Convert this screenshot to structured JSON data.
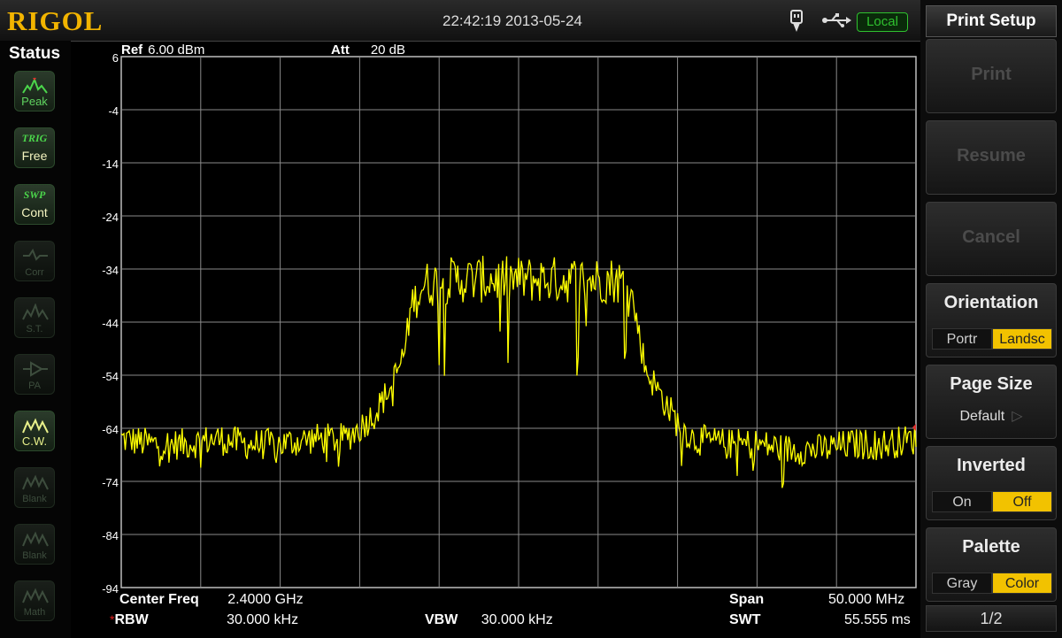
{
  "brand": "RIGOL",
  "datetime": "22:42:19 2013-05-24",
  "connection": "Local",
  "status": {
    "title": "Status",
    "buttons": [
      {
        "tag": "",
        "label": "Peak",
        "icon": "peak-icon",
        "active": true
      },
      {
        "tag": "TRIG",
        "label": "Free",
        "icon": "",
        "active": true
      },
      {
        "tag": "SWP",
        "label": "Cont",
        "icon": "",
        "active": true
      },
      {
        "tag": "",
        "label": "Corr",
        "icon": "correction-icon",
        "active": false
      },
      {
        "tag": "",
        "label": "S.T.",
        "icon": "signal-track-icon",
        "active": false
      },
      {
        "tag": "",
        "label": "PA",
        "icon": "preamp-icon",
        "active": false
      },
      {
        "tag": "",
        "label": "C.W.",
        "icon": "trace-icon",
        "active": true
      },
      {
        "tag": "",
        "label": "Blank",
        "icon": "trace-icon",
        "active": false
      },
      {
        "tag": "",
        "label": "Blank",
        "icon": "trace-icon",
        "active": false
      },
      {
        "tag": "",
        "label": "Math",
        "icon": "trace-icon",
        "active": false
      }
    ]
  },
  "measurement": {
    "ref_label": "Ref",
    "ref_value": "6.00 dBm",
    "att_label": "Att",
    "att_value": "20 dB",
    "center_label": "Center Freq",
    "center_value": "2.4000 GHz",
    "span_label": "Span",
    "span_value": "50.000 MHz",
    "rbw_label": "RBW",
    "rbw_value": "30.000 kHz",
    "rbw_mark": "*",
    "vbw_label": "VBW",
    "vbw_value": "30.000 kHz",
    "swt_label": "SWT",
    "swt_value": "55.555 ms"
  },
  "chart_data": {
    "type": "line",
    "ylabel": "",
    "xlabel": "",
    "y_ticks": [
      6,
      -4,
      -14,
      -24,
      -34,
      -44,
      -54,
      -64,
      -74,
      -84,
      -94
    ],
    "ylim": [
      -94,
      6
    ],
    "x_range_mhz": [
      2375,
      2425
    ],
    "grid": true,
    "trace_color": "#ffff00",
    "series": [
      {
        "values_dbm_by_mhz": [
          [
            2375,
            -66
          ],
          [
            2377,
            -67
          ],
          [
            2379,
            -67
          ],
          [
            2381,
            -66
          ],
          [
            2383,
            -67
          ],
          [
            2385,
            -67
          ],
          [
            2387,
            -66
          ],
          [
            2389,
            -66
          ],
          [
            2390,
            -64
          ],
          [
            2391,
            -61
          ],
          [
            2392,
            -56
          ],
          [
            2392.8,
            -50
          ],
          [
            2393.3,
            -40
          ],
          [
            2394,
            -37
          ],
          [
            2396,
            -36
          ],
          [
            2398,
            -36
          ],
          [
            2400,
            -36
          ],
          [
            2402,
            -36
          ],
          [
            2404,
            -36
          ],
          [
            2406,
            -36
          ],
          [
            2407,
            -37
          ],
          [
            2407.5,
            -45
          ],
          [
            2408,
            -53
          ],
          [
            2409,
            -58
          ],
          [
            2410,
            -63
          ],
          [
            2411,
            -66
          ],
          [
            2413,
            -67
          ],
          [
            2415,
            -67
          ],
          [
            2417,
            -68
          ],
          [
            2419,
            -68
          ],
          [
            2421,
            -67
          ],
          [
            2423,
            -67
          ],
          [
            2425,
            -66
          ]
        ]
      }
    ]
  },
  "menu": {
    "title": "Print Setup",
    "print": "Print",
    "resume": "Resume",
    "cancel": "Cancel",
    "orientation": {
      "label": "Orientation",
      "options": [
        "Portr",
        "Landsc"
      ],
      "selected": 1
    },
    "page_size": {
      "label": "Page Size",
      "value": "Default"
    },
    "inverted": {
      "label": "Inverted",
      "options": [
        "On",
        "Off"
      ],
      "selected": 1
    },
    "palette": {
      "label": "Palette",
      "options": [
        "Gray",
        "Color"
      ],
      "selected": 1
    },
    "page": "1/2"
  },
  "colors": {
    "brand": "#f2b400",
    "trace": "#ffff00",
    "selected": "#f2c200",
    "local": "#2fc12f"
  }
}
